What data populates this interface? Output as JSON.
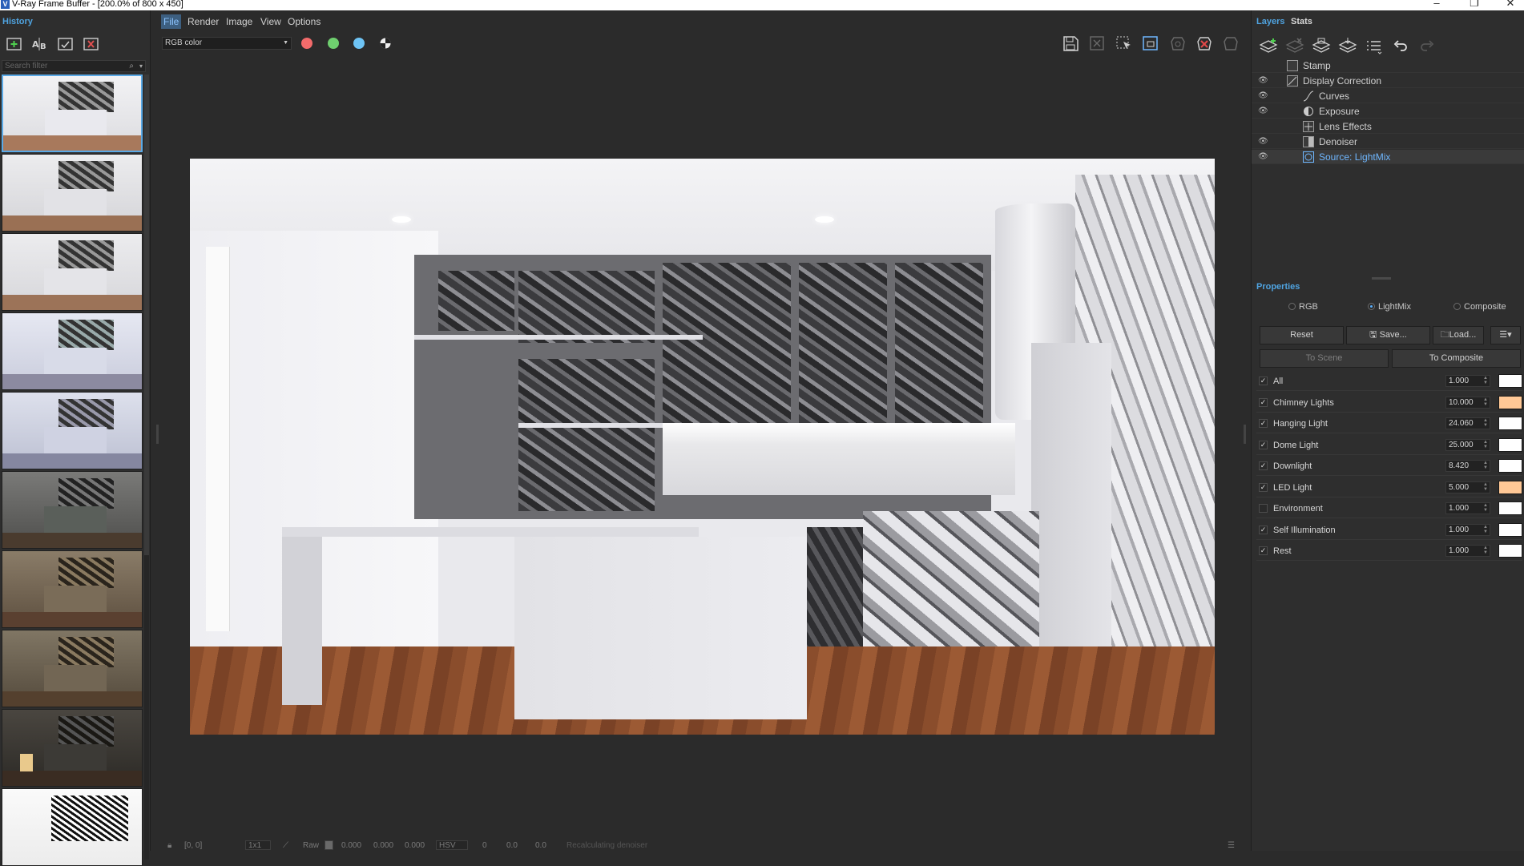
{
  "window": {
    "title": "V-Ray Frame Buffer - [200.0% of 800 x 450]",
    "app_icon_letter": "V",
    "controls": [
      "–",
      "❐",
      "✕"
    ]
  },
  "history": {
    "title": "History",
    "search_placeholder": "Search filter",
    "tools": [
      "add-icon",
      "ab-compare-icon",
      "save-icon",
      "delete-icon"
    ]
  },
  "menu": {
    "items": [
      "File",
      "Render",
      "Image",
      "View",
      "Options"
    ],
    "active": "File"
  },
  "toolbar": {
    "channel": "RGB color",
    "channel_dots": [
      "#f36b6b",
      "#6fcf6f",
      "#6ec4f5"
    ],
    "icons": [
      "save-image-icon",
      "clear-image-icon",
      "region-render-icon",
      "follow-mouse-icon",
      "render-last-icon",
      "stop-render-icon",
      "render-icon"
    ]
  },
  "statusbar": {
    "coords": "[0, 0]",
    "zoom": "1x1",
    "mode": "Raw",
    "r": "0.000",
    "g": "0.000",
    "b": "0.000",
    "colorspace": "HSV",
    "h": "0",
    "s": "0.0",
    "v": "0.0",
    "message": "Recalculating denoiser"
  },
  "layers_panel": {
    "tabs": [
      "Layers",
      "Stats"
    ],
    "active_tab": "Layers",
    "layers": [
      {
        "name": "Stamp",
        "visible": false,
        "indent": 0,
        "icon": "stamp-icon",
        "selected": false
      },
      {
        "name": "Display Correction",
        "visible": true,
        "indent": 0,
        "icon": "display-correction-icon",
        "selected": false
      },
      {
        "name": "Curves",
        "visible": true,
        "indent": 1,
        "icon": "curves-icon",
        "selected": false
      },
      {
        "name": "Exposure",
        "visible": true,
        "indent": 1,
        "icon": "exposure-icon",
        "selected": false
      },
      {
        "name": "Lens Effects",
        "visible": false,
        "indent": 1,
        "icon": "lens-effects-icon",
        "selected": false
      },
      {
        "name": "Denoiser",
        "visible": true,
        "indent": 1,
        "icon": "denoiser-icon",
        "selected": false
      },
      {
        "name": "Source: LightMix",
        "visible": true,
        "indent": 1,
        "icon": "lightmix-icon",
        "selected": true
      }
    ]
  },
  "properties": {
    "title": "Properties",
    "modes": [
      "RGB",
      "LightMix",
      "Composite"
    ],
    "selected_mode": "LightMix",
    "buttons": {
      "reset": "Reset",
      "save": "Save...",
      "load": "Load...",
      "to_scene": "To Scene",
      "to_composite": "To Composite"
    },
    "lights": [
      {
        "name": "All",
        "checked": true,
        "value": "1.000",
        "color": "#ffffff"
      },
      {
        "name": "Chimney Lights",
        "checked": true,
        "value": "10.000",
        "color": "#ffc896"
      },
      {
        "name": "Hanging Light",
        "checked": true,
        "value": "24.060",
        "color": "#ffffff"
      },
      {
        "name": "Dome Light",
        "checked": true,
        "value": "25.000",
        "color": "#ffffff"
      },
      {
        "name": "Downlight",
        "checked": true,
        "value": "8.420",
        "color": "#ffffff"
      },
      {
        "name": "LED Light",
        "checked": true,
        "value": "5.000",
        "color": "#ffc896"
      },
      {
        "name": "Environment",
        "checked": false,
        "value": "1.000",
        "color": "#ffffff"
      },
      {
        "name": "Self Illumination",
        "checked": true,
        "value": "1.000",
        "color": "#ffffff"
      },
      {
        "name": "Rest",
        "checked": true,
        "value": "1.000",
        "color": "#ffffff"
      }
    ]
  }
}
